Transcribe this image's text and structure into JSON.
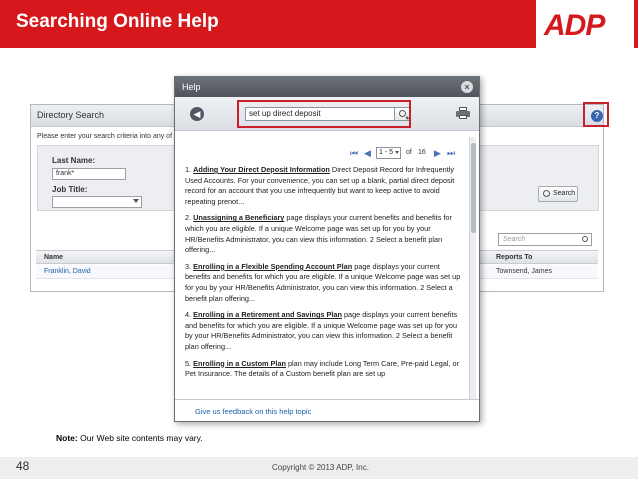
{
  "slide": {
    "title": "Searching Online Help",
    "logo": "ADP",
    "note_label": "Note:",
    "note_text": " Our Web site contents may vary.",
    "page_number": "48",
    "copyright": "Copyright © 2013 ADP, Inc."
  },
  "directory": {
    "title": "Directory Search",
    "prompt": "Please enter your search criteria into any of",
    "last_name_label": "Last Name:",
    "last_name_value": "frank*",
    "job_title_label": "Job Title:",
    "job_title_value": "",
    "search_button": "Search",
    "search_placeholder": "Search",
    "columns": [
      "Name",
      "Reports To"
    ],
    "rows": [
      {
        "name": "Franklin, David",
        "reports_to": "Townsend, James"
      }
    ],
    "help_icon": "question-icon"
  },
  "help": {
    "title": "Help",
    "search_value": "set up direct deposit",
    "page_range": "1 - 5",
    "of_label": "of",
    "total_pages": "16",
    "results": [
      {
        "num": "1.",
        "title": "Adding Your Direct Deposit Information",
        "text": " Direct Deposit Record for Infrequently Used Accounts. For your convenience, you can set up a blank, partial direct deposit record for an account that you use infrequently but want to keep active to avoid repeating prenot..."
      },
      {
        "num": "2.",
        "title": "Unassigning a Beneficiary",
        "text": " page displays your current benefits and benefits for which you are eligible. If a unique Welcome page was set up for you by your HR/Benefits Administrator, you can view this information. 2 Select a benefit plan offering..."
      },
      {
        "num": "3.",
        "title": "Enrolling in a Flexible Spending Account Plan",
        "text": " page displays your current benefits and benefits for which you are eligible. If a unique Welcome page was set up for you by your HR/Benefits Administrator, you can view this information. 2 Select a benefit plan offering..."
      },
      {
        "num": "4.",
        "title": "Enrolling in a Retirement and Savings Plan",
        "text": " page displays your current benefits and benefits for which you are eligible. If a unique Welcome page was set up for you by your HR/Benefits Administrator, you can view this information. 2 Select a benefit plan offering..."
      },
      {
        "num": "5.",
        "title": "Enrolling in a Custom Plan",
        "text": " plan may include Long Term Care, Pre-paid Legal, or Pet Insurance. The details of a Custom benefit plan are set up"
      }
    ],
    "feedback": "Give us feedback on this help topic"
  },
  "colors": {
    "brand_red": "#d6171c",
    "highlight_red": "#c8202b",
    "link_blue": "#1d5ea8"
  }
}
